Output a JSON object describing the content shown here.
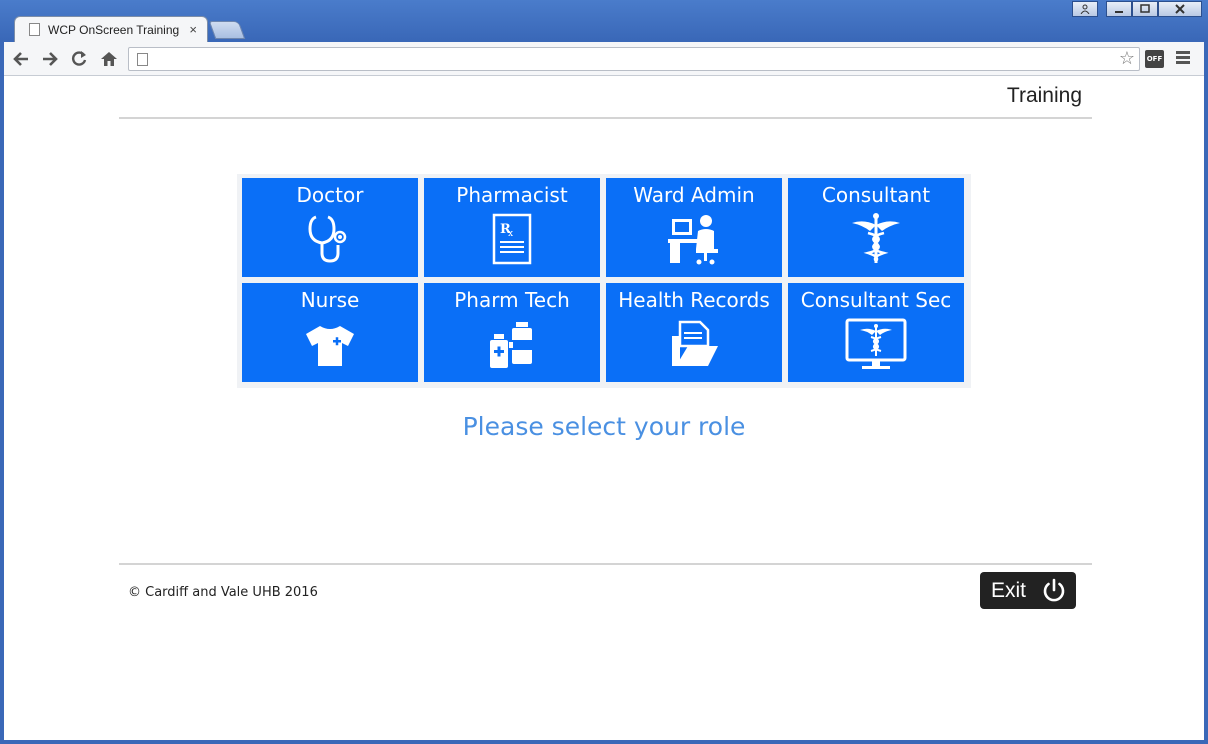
{
  "browser": {
    "tab_title": "WCP OnScreen Training",
    "tab_close": "×",
    "ext_label": "OFF",
    "address": ""
  },
  "header": {
    "title": "Training"
  },
  "roles": [
    {
      "label": "Doctor",
      "icon": "stethoscope-icon"
    },
    {
      "label": "Pharmacist",
      "icon": "prescription-icon"
    },
    {
      "label": "Ward Admin",
      "icon": "admin-desk-icon"
    },
    {
      "label": "Consultant",
      "icon": "caduceus-icon"
    },
    {
      "label": "Nurse",
      "icon": "nurse-shirt-icon"
    },
    {
      "label": "Pharm Tech",
      "icon": "medicine-bottles-icon"
    },
    {
      "label": "Health Records",
      "icon": "records-folder-icon"
    },
    {
      "label": "Consultant Sec",
      "icon": "monitor-caduceus-icon"
    }
  ],
  "prompt": "Please select your role",
  "footer": {
    "copyright": "© Cardiff and Vale UHB 2016"
  },
  "exit": {
    "label": "Exit",
    "icon": "power-icon"
  },
  "colors": {
    "tile": "#0a6ff7",
    "prompt": "#4a90e2",
    "exit_bg": "#222222"
  }
}
